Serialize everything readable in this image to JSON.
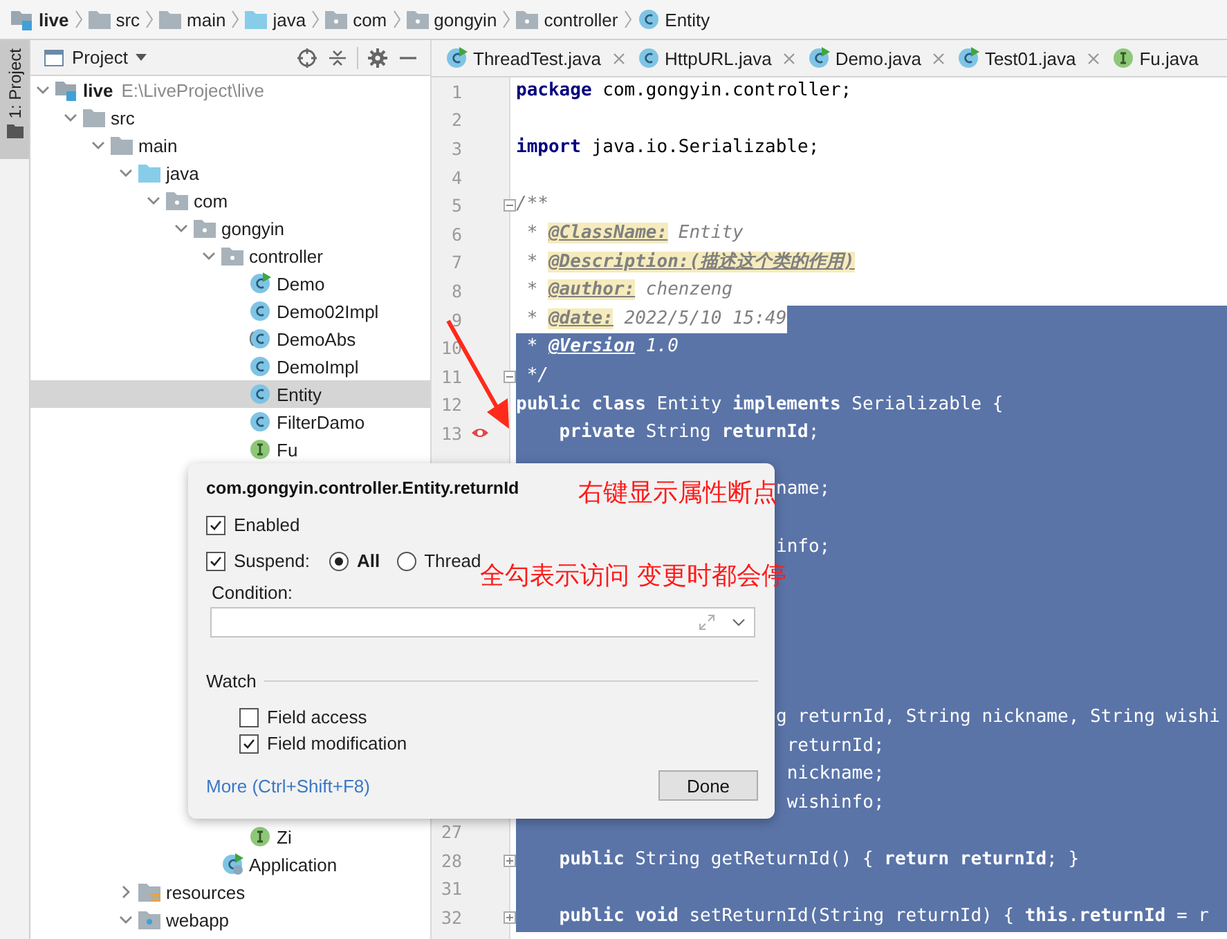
{
  "breadcrumbs": [
    {
      "label": "live",
      "kind": "module"
    },
    {
      "label": "src",
      "kind": "folder"
    },
    {
      "label": "main",
      "kind": "folder"
    },
    {
      "label": "java",
      "kind": "source-folder"
    },
    {
      "label": "com",
      "kind": "package"
    },
    {
      "label": "gongyin",
      "kind": "package"
    },
    {
      "label": "controller",
      "kind": "package"
    },
    {
      "label": "Entity",
      "kind": "class"
    }
  ],
  "tool_strip": {
    "label": "1: Project",
    "selected": true
  },
  "project_panel": {
    "title": "Project",
    "tree": [
      {
        "label": "live",
        "path": "E:\\LiveProject\\live",
        "kind": "module",
        "expanded": true,
        "selected": false,
        "children": [
          {
            "label": "src",
            "kind": "folder",
            "expanded": true,
            "selected": false,
            "children": [
              {
                "label": "main",
                "kind": "folder",
                "expanded": true,
                "selected": false,
                "children": [
                  {
                    "label": "java",
                    "kind": "source-folder",
                    "expanded": true,
                    "selected": false,
                    "children": [
                      {
                        "label": "com",
                        "kind": "package",
                        "expanded": true,
                        "selected": false,
                        "children": [
                          {
                            "label": "gongyin",
                            "kind": "package",
                            "expanded": true,
                            "selected": false,
                            "children": [
                              {
                                "label": "controller",
                                "kind": "package",
                                "expanded": true,
                                "selected": false,
                                "children": [
                                  {
                                    "label": "Demo",
                                    "kind": "runnable-class",
                                    "selected": false
                                  },
                                  {
                                    "label": "Demo02Impl",
                                    "kind": "class",
                                    "selected": false
                                  },
                                  {
                                    "label": "DemoAbs",
                                    "kind": "abstract-class",
                                    "selected": false
                                  },
                                  {
                                    "label": "DemoImpl",
                                    "kind": "class",
                                    "selected": false
                                  },
                                  {
                                    "label": "Entity",
                                    "kind": "class",
                                    "selected": true
                                  },
                                  {
                                    "label": "FilterDamo",
                                    "kind": "class",
                                    "selected": false
                                  },
                                  {
                                    "label": "Fu",
                                    "kind": "interface",
                                    "selected": false
                                  },
                                  {
                                    "label": "Zi",
                                    "kind": "interface",
                                    "selected": false,
                                    "gap_above": true
                                  }
                                ]
                              },
                              {
                                "label": "Application",
                                "kind": "app-class",
                                "selected": false
                              }
                            ]
                          }
                        ]
                      }
                    ]
                  },
                  {
                    "label": "resources",
                    "kind": "resources-folder",
                    "expanded": false,
                    "selected": false
                  },
                  {
                    "label": "webapp",
                    "kind": "web-folder",
                    "expanded": true,
                    "selected": false
                  }
                ]
              }
            ]
          }
        ]
      }
    ]
  },
  "editor_tabs": [
    {
      "label": "ThreadTest.java",
      "kind": "runnable-class",
      "closable": true
    },
    {
      "label": "HttpURL.java",
      "kind": "class",
      "closable": true
    },
    {
      "label": "Demo.java",
      "kind": "runnable-class",
      "closable": true
    },
    {
      "label": "Test01.java",
      "kind": "runnable-class",
      "closable": true
    },
    {
      "label": "Fu.java",
      "kind": "interface",
      "closable": false
    }
  ],
  "editor": {
    "lines": [
      {
        "number": "1",
        "selected": false,
        "segments": [
          {
            "kind": "keyword",
            "text": "package"
          },
          {
            "kind": "plain",
            "text": " com.gongyin.controller;"
          }
        ]
      },
      {
        "number": "2",
        "selected": false
      },
      {
        "number": "3",
        "selected": false,
        "segments": [
          {
            "kind": "keyword",
            "text": "import"
          },
          {
            "kind": "plain",
            "text": " java.io.Serializable;"
          }
        ]
      },
      {
        "number": "4",
        "selected": false
      },
      {
        "number": "5",
        "selected": false,
        "fold_start": true,
        "segments": [
          {
            "kind": "doc",
            "text": "/**"
          }
        ]
      },
      {
        "number": "6",
        "selected": false,
        "segments": [
          {
            "kind": "doc",
            "text": " * "
          },
          {
            "kind": "tag",
            "text": "@ClassName:"
          },
          {
            "kind": "doc",
            "text": " Entity"
          }
        ]
      },
      {
        "number": "7",
        "selected": false,
        "segments": [
          {
            "kind": "doc",
            "text": " * "
          },
          {
            "kind": "tag",
            "text": "@Description:(描述这个类的作用)"
          }
        ]
      },
      {
        "number": "8",
        "selected": false,
        "segments": [
          {
            "kind": "doc",
            "text": " * "
          },
          {
            "kind": "tag",
            "text": "@author:"
          },
          {
            "kind": "doc",
            "text": " chenzeng"
          }
        ]
      },
      {
        "number": "9",
        "selected": false,
        "selected_after_text": true,
        "segments": [
          {
            "kind": "doc",
            "text": " * "
          },
          {
            "kind": "tag",
            "text": "@date:"
          },
          {
            "kind": "doc",
            "text": " 2022/5/10 15:49"
          }
        ]
      },
      {
        "number": "10",
        "selected": true,
        "segments": [
          {
            "kind": "doc",
            "text": " * "
          },
          {
            "kind": "tag",
            "text": "@Version"
          },
          {
            "kind": "doc",
            "text": " 1.0"
          }
        ]
      },
      {
        "number": "11",
        "selected": true,
        "fold_end": true,
        "segments": [
          {
            "kind": "doc",
            "text": " */"
          }
        ]
      },
      {
        "number": "12",
        "selected": true,
        "segments": [
          {
            "kind": "keyword",
            "text": "public class"
          },
          {
            "kind": "plain",
            "text": " Entity "
          },
          {
            "kind": "keyword",
            "text": "implements"
          },
          {
            "kind": "plain",
            "text": " Serializable {"
          }
        ]
      },
      {
        "number": "13",
        "selected": true,
        "breakpoint": true,
        "segments": [
          {
            "kind": "keyword",
            "text": "    private"
          },
          {
            "kind": "plain",
            "text": " String "
          },
          {
            "kind": "field",
            "text": "returnId"
          },
          {
            "kind": "plain",
            "text": ";"
          }
        ]
      },
      {
        "selected": true
      },
      {
        "selected": true,
        "clipped": true,
        "segments": [
          {
            "kind": "plain",
            "text": "name;"
          }
        ]
      },
      {
        "selected": true
      },
      {
        "selected": true,
        "clipped": true,
        "segments": [
          {
            "kind": "plain",
            "text": "info;"
          }
        ]
      },
      {
        "selected": true
      },
      {
        "selected": true
      },
      {
        "selected": true
      },
      {
        "selected": true
      },
      {
        "selected": true
      },
      {
        "selected": true,
        "clipped": true,
        "segments": [
          {
            "kind": "plain",
            "text": "g returnId, String nickname, String wishi"
          }
        ]
      },
      {
        "selected": true,
        "clipped": true,
        "segments": [
          {
            "kind": "plain",
            "text": " returnId;"
          }
        ]
      },
      {
        "selected": true,
        "clipped": true,
        "segments": [
          {
            "kind": "plain",
            "text": " nickname;"
          }
        ]
      },
      {
        "selected": true,
        "clipped": true,
        "segments": [
          {
            "kind": "plain",
            "text": " wishinfo;"
          }
        ]
      },
      {
        "number": "27",
        "selected": true
      },
      {
        "number": "28",
        "selected": true,
        "folded": true,
        "segments": [
          {
            "kind": "keyword",
            "text": "    public"
          },
          {
            "kind": "plain",
            "text": " String getReturnId() { "
          },
          {
            "kind": "keyword",
            "text": "return"
          },
          {
            "kind": "field",
            "text": " returnId"
          },
          {
            "kind": "plain",
            "text": "; }"
          }
        ]
      },
      {
        "number": "31",
        "selected": true
      },
      {
        "number": "32",
        "selected": true,
        "folded": true,
        "segments": [
          {
            "kind": "keyword",
            "text": "    public void"
          },
          {
            "kind": "plain",
            "text": " setReturnId(String returnId) { "
          },
          {
            "kind": "keyword",
            "text": "this"
          },
          {
            "kind": "plain",
            "text": "."
          },
          {
            "kind": "field",
            "text": "returnId"
          },
          {
            "kind": "plain",
            "text": " = r"
          }
        ]
      }
    ]
  },
  "breakpoint_popup": {
    "title": "com.gongyin.controller.Entity.returnId",
    "enabled": {
      "label": "Enabled",
      "checked": true
    },
    "suspend": {
      "label": "Suspend:",
      "checked": true
    },
    "suspend_options": [
      {
        "label": "All",
        "selected": true
      },
      {
        "label": "Thread",
        "selected": false
      }
    ],
    "condition": {
      "label": "Condition:"
    },
    "watch": {
      "title": "Watch",
      "options": [
        {
          "label": "Field access",
          "checked": false
        },
        {
          "label": "Field modification",
          "checked": true
        }
      ]
    },
    "more_link": "More (Ctrl+Shift+F8)",
    "done_button": "Done"
  },
  "annotations": [
    {
      "text": "右键显示属性断点"
    },
    {
      "text": "全勾表示访问 变更时都会停"
    }
  ]
}
